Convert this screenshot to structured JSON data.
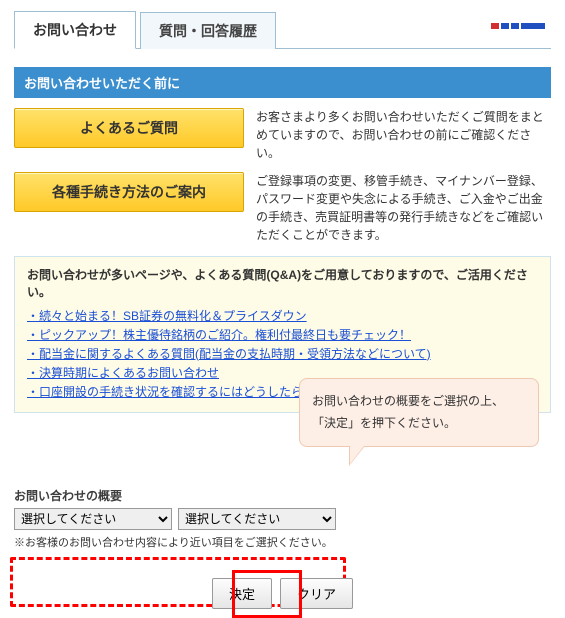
{
  "tabs": {
    "inquiry": "お問い合わせ",
    "history": "質問・回答履歴"
  },
  "section_title": "お問い合わせいただく前に",
  "faq_button": "よくあるご質問",
  "faq_text": "お客さまより多くお問い合わせいただくご質問をまとめていますので、お問い合わせの前にご確認ください。",
  "proc_button": "各種手続き方法のご案内",
  "proc_text": "ご登録事項の変更、移管手続き、マイナンバー登録、パスワード変更や失念による手続き、ご入金やご出金の手続き、売買証明書等の発行手続きなどをご確認いただくことができます。",
  "note_title": "お問い合わせが多いページや、よくある質問(Q&A)をご用意しておりますので、ご活用ください。",
  "links": [
    "・続々と始まる！SB証券の無料化＆プライスダウン",
    "・ピックアップ！株主優待銘柄のご紹介。権利付最終日も要チェック！",
    "・配当金に関するよくある質問(配当金の支払時期・受領方法などについて)",
    "・決算時期によくあるお問い合わせ",
    "・口座開設の手続き状況を確認するにはどうしたらいいですか？"
  ],
  "callout_line1": "お問い合わせの概要をご選択の上、",
  "callout_line2": "「決定」を押下ください。",
  "summary_label": "お問い合わせの概要",
  "select_default": "選択してください",
  "select_note": "※お客様のお問い合わせ内容により近い項目をご選択ください。",
  "submit": "決定",
  "clear": "クリア"
}
